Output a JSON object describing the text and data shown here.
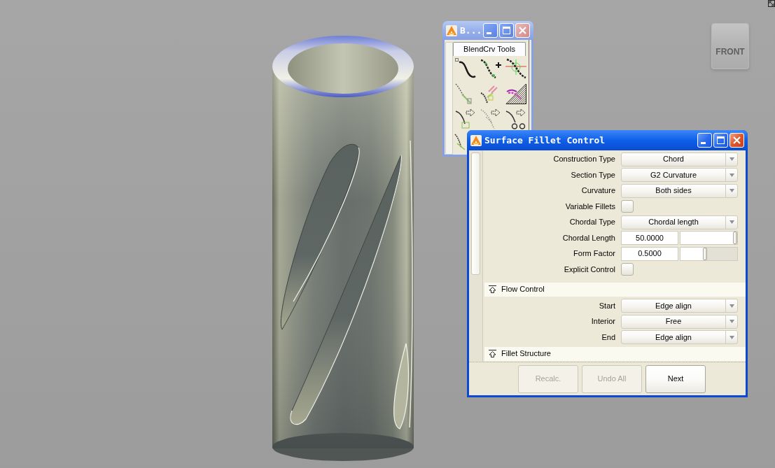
{
  "viewport": {
    "view_cube": {
      "label": "FRONT"
    }
  },
  "blend_window": {
    "title": "B...",
    "active": false,
    "tabs": [
      {
        "label": "BlendCrv Tools",
        "selected": true
      }
    ]
  },
  "dialog": {
    "title": "Surface Fillet Control",
    "active": true,
    "rows": [
      {
        "label": "Construction Type",
        "kind": "dropdown",
        "value": "Chord"
      },
      {
        "label": "Section Type",
        "kind": "dropdown",
        "value": "G2 Curvature"
      },
      {
        "label": "Curvature",
        "kind": "dropdown",
        "value": "Both sides"
      },
      {
        "label": "Variable Fillets",
        "kind": "checkbox",
        "checked": false
      },
      {
        "label": "Chordal Type",
        "kind": "dropdown",
        "value": "Chordal length"
      },
      {
        "label": "Chordal Length",
        "kind": "slider",
        "value": "50.0000",
        "level": 1
      },
      {
        "label": "Form Factor",
        "kind": "slider",
        "value": "0.5000",
        "level": 0.43
      },
      {
        "label": "Explicit Control",
        "kind": "checkbox",
        "checked": false
      }
    ],
    "sections": [
      {
        "title": "Flow Control",
        "expanded": true,
        "rows": [
          {
            "label": "Start",
            "kind": "dropdown",
            "value": "Edge align"
          },
          {
            "label": "Interior",
            "kind": "dropdown",
            "value": "Free"
          },
          {
            "label": "End",
            "kind": "dropdown",
            "value": "Edge align"
          }
        ]
      },
      {
        "title": "Fillet Structure",
        "expanded": true
      }
    ],
    "buttons": [
      {
        "label": "Recalc.",
        "disabled": true
      },
      {
        "label": "Undo All",
        "disabled": true
      },
      {
        "label": "Next",
        "disabled": false
      }
    ]
  }
}
